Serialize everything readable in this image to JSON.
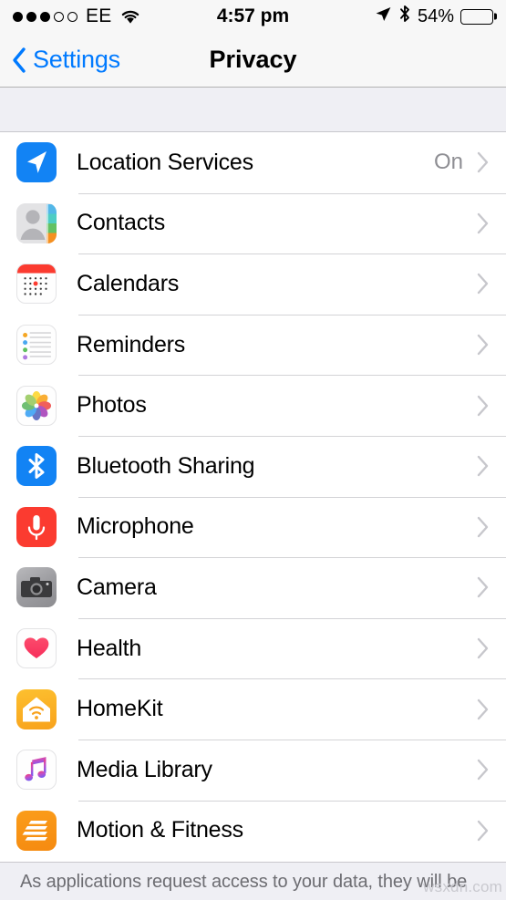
{
  "status_bar": {
    "signal_dots_total": 5,
    "signal_dots_filled": 3,
    "carrier": "EE",
    "wifi_icon": "wifi-icon",
    "time": "4:57 pm",
    "location_icon": "location-arrow-icon",
    "bluetooth_icon": "bluetooth-icon",
    "battery_percent": "54%",
    "battery_level": 54
  },
  "nav": {
    "back_label": "Settings",
    "back_icon": "chevron-left-icon",
    "title": "Privacy",
    "accent_color": "#007AFF"
  },
  "list": {
    "rows": [
      {
        "label": "Location Services",
        "value": "On",
        "icon": "location-services-icon",
        "chevron": "chevron-right-icon"
      },
      {
        "label": "Contacts",
        "value": "",
        "icon": "contacts-icon",
        "chevron": "chevron-right-icon"
      },
      {
        "label": "Calendars",
        "value": "",
        "icon": "calendars-icon",
        "chevron": "chevron-right-icon"
      },
      {
        "label": "Reminders",
        "value": "",
        "icon": "reminders-icon",
        "chevron": "chevron-right-icon"
      },
      {
        "label": "Photos",
        "value": "",
        "icon": "photos-icon",
        "chevron": "chevron-right-icon"
      },
      {
        "label": "Bluetooth Sharing",
        "value": "",
        "icon": "bluetooth-sharing-icon",
        "chevron": "chevron-right-icon"
      },
      {
        "label": "Microphone",
        "value": "",
        "icon": "microphone-icon",
        "chevron": "chevron-right-icon"
      },
      {
        "label": "Camera",
        "value": "",
        "icon": "camera-icon",
        "chevron": "chevron-right-icon"
      },
      {
        "label": "Health",
        "value": "",
        "icon": "health-icon",
        "chevron": "chevron-right-icon"
      },
      {
        "label": "HomeKit",
        "value": "",
        "icon": "homekit-icon",
        "chevron": "chevron-right-icon"
      },
      {
        "label": "Media Library",
        "value": "",
        "icon": "media-library-icon",
        "chevron": "chevron-right-icon"
      },
      {
        "label": "Motion & Fitness",
        "value": "",
        "icon": "motion-fitness-icon",
        "chevron": "chevron-right-icon"
      }
    ]
  },
  "footer": {
    "text": "As applications request access to your data, they will be",
    "watermark": "wsxdn.com"
  },
  "colors": {
    "ios_blue": "#007AFF",
    "group_bg": "#EFEFF4",
    "separator": "#D3D3D6",
    "value_gray": "#8E8E93",
    "chevron_gray": "#C7C7CC"
  }
}
